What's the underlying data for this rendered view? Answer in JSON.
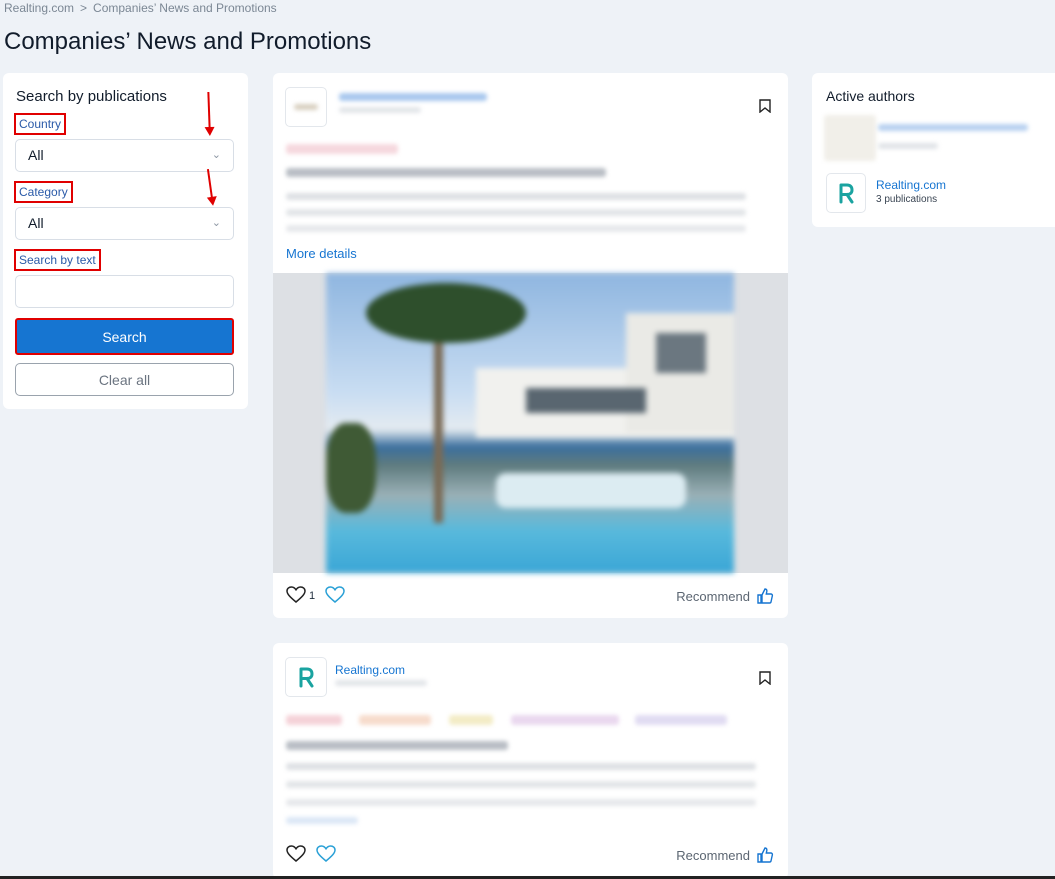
{
  "breadcrumb": {
    "home": "Realting.com",
    "separator": ">",
    "current": "Companies’ News and Promotions"
  },
  "page_title": "Companies’ News and Promotions",
  "filter": {
    "title": "Search by publications",
    "country_label": "Country",
    "country_value": "All",
    "category_label": "Category",
    "category_value": "All",
    "text_label": "Search by text",
    "text_value": "",
    "search_button": "Search",
    "clear_button": "Clear all"
  },
  "posts": [
    {
      "more_details": "More details",
      "like_count": "1",
      "recommend": "Recommend"
    },
    {
      "author": "Realting.com",
      "recommend": "Recommend"
    }
  ],
  "authors_panel": {
    "title": "Active authors",
    "items": [
      {
        "name": "Realting.com",
        "count": "3 publications"
      }
    ]
  },
  "colors": {
    "accent": "#1675d1",
    "highlight": "#e00000",
    "background": "#eef2f7"
  }
}
